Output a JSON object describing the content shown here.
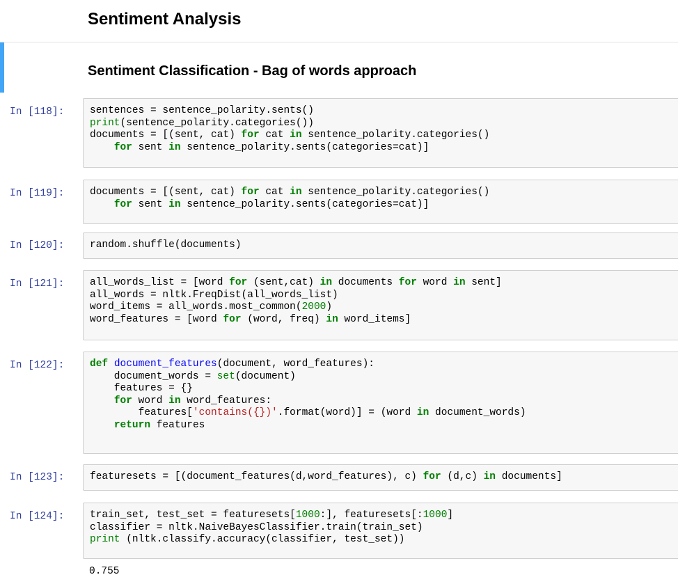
{
  "title": "Sentiment Analysis",
  "subtitle": "Sentiment Classification - Bag of words approach",
  "cells": [
    {
      "prompt": "In [118]:",
      "lines": [
        [
          [
            "sentences = sentence_polarity.sents()",
            ""
          ]
        ],
        [
          [
            "print",
            "bi"
          ],
          [
            "(sentence_polarity.categories())",
            ""
          ]
        ],
        [
          [
            "documents = [(sent, cat) ",
            ""
          ],
          [
            "for",
            "kw"
          ],
          [
            " cat ",
            ""
          ],
          [
            "in",
            "kw"
          ],
          [
            " sentence_polarity.categories()",
            ""
          ]
        ],
        [
          [
            "    ",
            ""
          ],
          [
            "for",
            "kw"
          ],
          [
            " sent ",
            ""
          ],
          [
            "in",
            "kw"
          ],
          [
            " sentence_polarity.sents(categories=cat)]",
            ""
          ]
        ]
      ]
    },
    {
      "prompt": "In [119]:",
      "lines": [
        [
          [
            "documents = [(sent, cat) ",
            ""
          ],
          [
            "for",
            "kw"
          ],
          [
            " cat ",
            ""
          ],
          [
            "in",
            "kw"
          ],
          [
            " sentence_polarity.categories()",
            ""
          ]
        ],
        [
          [
            "    ",
            ""
          ],
          [
            "for",
            "kw"
          ],
          [
            " sent ",
            ""
          ],
          [
            "in",
            "kw"
          ],
          [
            " sentence_polarity.sents(categories=cat)]",
            ""
          ]
        ]
      ]
    },
    {
      "prompt": "In [120]:",
      "lines": [
        [
          [
            "random.shuffle(documents)",
            ""
          ]
        ]
      ]
    },
    {
      "prompt": "In [121]:",
      "lines": [
        [
          [
            "all_words_list = [word ",
            ""
          ],
          [
            "for",
            "kw"
          ],
          [
            " (sent,cat) ",
            ""
          ],
          [
            "in",
            "kw"
          ],
          [
            " documents ",
            ""
          ],
          [
            "for",
            "kw"
          ],
          [
            " word ",
            ""
          ],
          [
            "in",
            "kw"
          ],
          [
            " sent]",
            ""
          ]
        ],
        [
          [
            "all_words = nltk.FreqDist(all_words_list)",
            ""
          ]
        ],
        [
          [
            "word_items = all_words.most_common(",
            ""
          ],
          [
            "2000",
            "num"
          ],
          [
            ")",
            ""
          ]
        ],
        [
          [
            "word_features = [word ",
            ""
          ],
          [
            "for",
            "kw"
          ],
          [
            " (word, freq) ",
            ""
          ],
          [
            "in",
            "kw"
          ],
          [
            " word_items]",
            ""
          ]
        ]
      ]
    },
    {
      "prompt": "In [122]:",
      "lines": [
        [
          [
            "def",
            "kw"
          ],
          [
            " ",
            ""
          ],
          [
            "document_features",
            "fn"
          ],
          [
            "(document, word_features):",
            ""
          ]
        ],
        [
          [
            "    document_words = ",
            ""
          ],
          [
            "set",
            "bi"
          ],
          [
            "(document)",
            ""
          ]
        ],
        [
          [
            "    features = {}",
            ""
          ]
        ],
        [
          [
            "    ",
            ""
          ],
          [
            "for",
            "kw"
          ],
          [
            " word ",
            ""
          ],
          [
            "in",
            "kw"
          ],
          [
            " word_features:",
            ""
          ]
        ],
        [
          [
            "        features[",
            ""
          ],
          [
            "'contains({})'",
            "str"
          ],
          [
            ".format(word)] = (word ",
            ""
          ],
          [
            "in",
            "kw"
          ],
          [
            " document_words)",
            ""
          ]
        ],
        [
          [
            "    ",
            ""
          ],
          [
            "return",
            "kw"
          ],
          [
            " features",
            ""
          ]
        ]
      ]
    },
    {
      "prompt": "In [123]:",
      "lines": [
        [
          [
            "featuresets = [(document_features(d,word_features), c) ",
            ""
          ],
          [
            "for",
            "kw"
          ],
          [
            " (d,c) ",
            ""
          ],
          [
            "in",
            "kw"
          ],
          [
            " documents]",
            ""
          ]
        ]
      ]
    },
    {
      "prompt": "In [124]:",
      "lines": [
        [
          [
            "train_set, test_set = featuresets[",
            ""
          ],
          [
            "1000",
            "num"
          ],
          [
            ":], featuresets[:",
            ""
          ],
          [
            "1000",
            "num"
          ],
          [
            "]",
            ""
          ]
        ],
        [
          [
            "classifier = nltk.NaiveBayesClassifier.train(train_set)",
            ""
          ]
        ],
        [
          [
            "print",
            "bi"
          ],
          [
            " (nltk.classify.accuracy(classifier, test_set))",
            ""
          ]
        ]
      ]
    }
  ],
  "output_124": "0.755"
}
